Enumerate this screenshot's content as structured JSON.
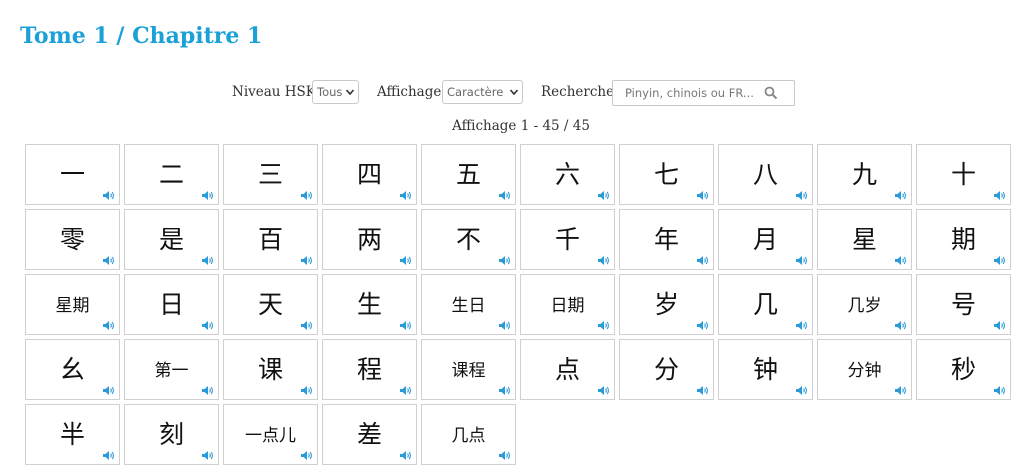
{
  "page": {
    "title": "Tome 1 / Chapitre 1"
  },
  "filters": {
    "hsk_label": "Niveau HSK",
    "hsk_value": "Tous",
    "display_label": "Affichage",
    "display_value": "Caractère",
    "search_label": "Recherche",
    "search_placeholder": "Pinyin, chinois ou FR..."
  },
  "results": {
    "count_text": "Affichage 1 - 45 / 45"
  },
  "icons": {
    "speaker": "speaker-icon",
    "search": "search-icon",
    "dropdown": "chevron-down-icon"
  },
  "colors": {
    "title": "#1ba0d8",
    "speaker": "#2a9bd8"
  },
  "cards": [
    "一",
    "二",
    "三",
    "四",
    "五",
    "六",
    "七",
    "八",
    "九",
    "十",
    "零",
    "是",
    "百",
    "两",
    "不",
    "千",
    "年",
    "月",
    "星",
    "期",
    "星期",
    "日",
    "天",
    "生",
    "生日",
    "日期",
    "岁",
    "几",
    "几岁",
    "号",
    "幺",
    "第一",
    "课",
    "程",
    "课程",
    "点",
    "分",
    "钟",
    "分钟",
    "秒",
    "半",
    "刻",
    "一点儿",
    "差",
    "几点"
  ]
}
